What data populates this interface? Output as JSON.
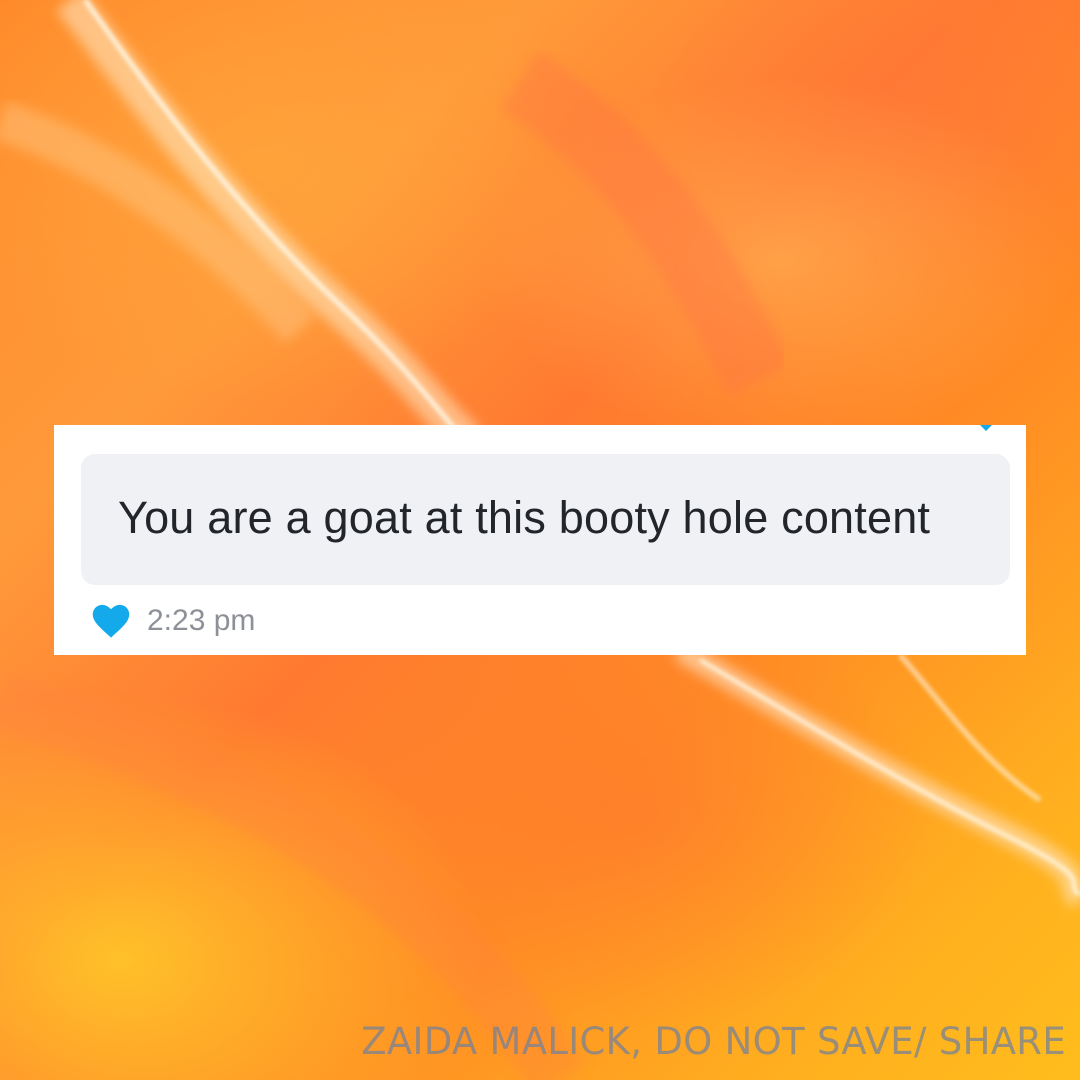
{
  "message": {
    "text": "You are a goat at this booty hole content",
    "timestamp": "2:23 pm",
    "reaction_icon": "heart-icon",
    "reaction_color": "#14a9ea"
  },
  "watermark": {
    "text": "ZAIDA MALICK, DO NOT SAVE/ SHARE"
  },
  "colors": {
    "background_accent": "#ff8a2a",
    "bubble": "#f0f1f4",
    "card": "#ffffff"
  }
}
